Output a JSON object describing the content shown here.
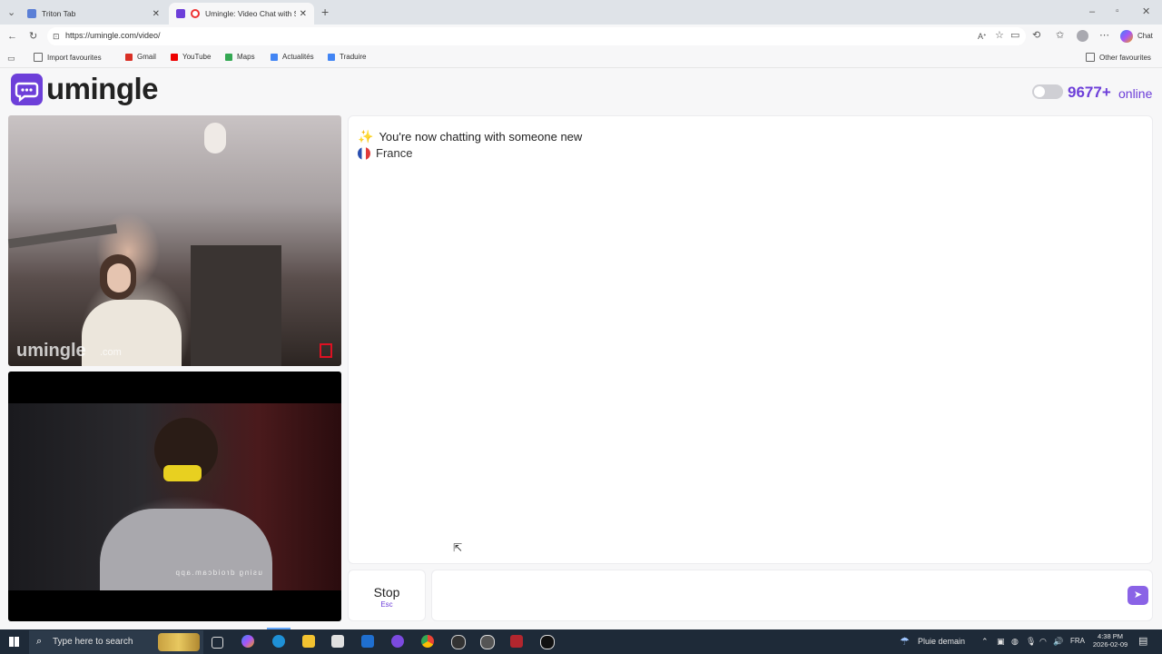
{
  "browser": {
    "tabs": [
      {
        "title": "Triton Tab"
      },
      {
        "title": "Umingle: Video Chat with Stra"
      }
    ],
    "url": "https://umingle.com/video/",
    "chat_label": "Chat",
    "bookmarks": [
      "Import favourites",
      "Gmail",
      "YouTube",
      "Maps",
      "Actualités",
      "Traduire"
    ],
    "other_bookmarks": "Other favourites"
  },
  "app": {
    "logo_text": "umingle",
    "online_count": "9677+",
    "online_label": "online"
  },
  "video": {
    "watermark": "umingle",
    "watermark_com": ".com",
    "mirror_text": "using droidcam.app"
  },
  "chat": {
    "status_message": "You're now chatting with someone new",
    "country": "France"
  },
  "controls": {
    "stop_label": "Stop",
    "stop_key": "Esc"
  },
  "taskbar": {
    "search_placeholder": "Type here to search",
    "weather": "Pluie demain",
    "language": "FRA",
    "time": "4:38 PM",
    "date": "2026-02-09"
  },
  "colors": {
    "brand": "#6d3fd9",
    "send_button": "#8a63e6"
  }
}
